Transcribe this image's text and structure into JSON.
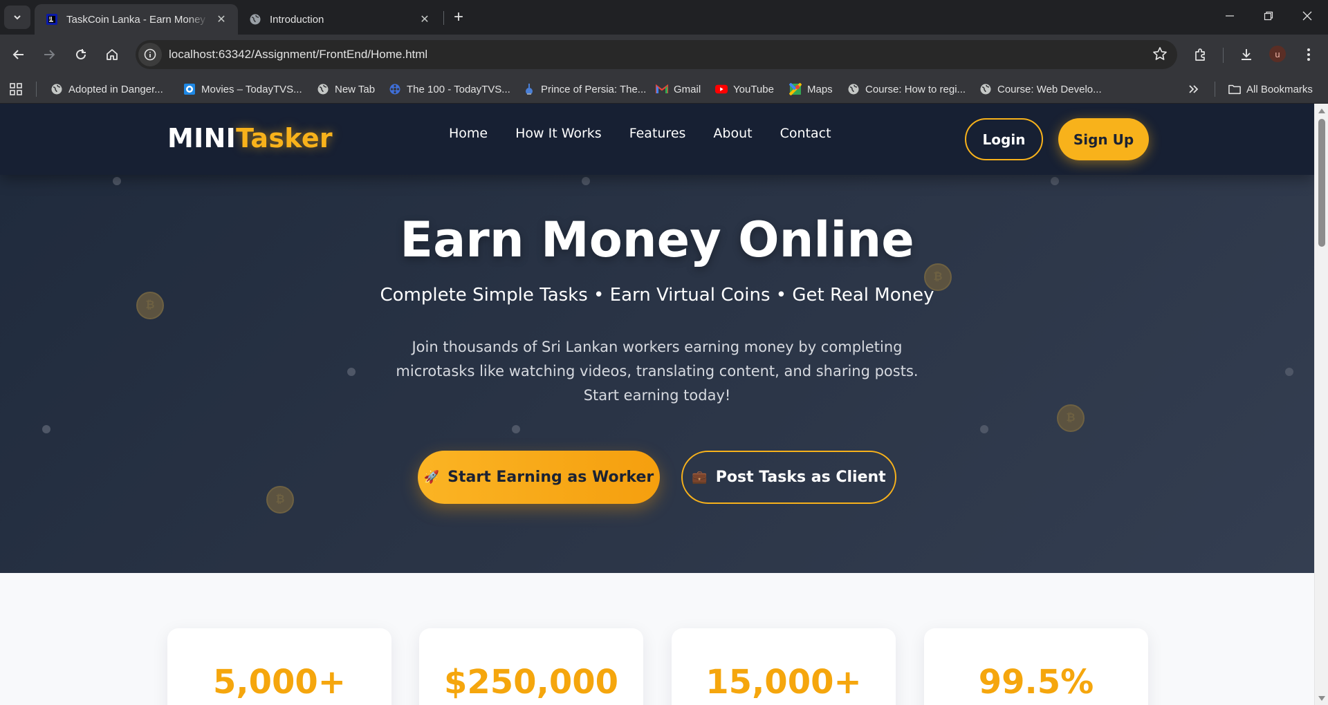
{
  "browser": {
    "tabs": [
      {
        "title": "TaskCoin Lanka - Earn Money O",
        "active": true
      },
      {
        "title": "Introduction",
        "active": false
      }
    ],
    "url": "localhost:63342/Assignment/FrontEnd/Home.html",
    "profile_initial": "u",
    "bookmarks": [
      {
        "label": "Adopted in Danger...",
        "icon": "globe-icon"
      },
      {
        "label": "Movies – TodayTVS...",
        "icon": "site-icon"
      },
      {
        "label": "New Tab",
        "icon": "globe-icon"
      },
      {
        "label": "The 100 - TodayTVS...",
        "icon": "reel-icon"
      },
      {
        "label": "Prince of Persia: The...",
        "icon": "game-icon"
      },
      {
        "label": "Gmail",
        "icon": "gmail-icon"
      },
      {
        "label": "YouTube",
        "icon": "youtube-icon"
      },
      {
        "label": "Maps",
        "icon": "maps-icon"
      },
      {
        "label": "Course: How to regi...",
        "icon": "globe-icon"
      },
      {
        "label": "Course: Web Develo...",
        "icon": "globe-icon"
      }
    ],
    "all_bookmarks_label": "All Bookmarks"
  },
  "site": {
    "logo": {
      "part1": "MINI",
      "part2": "Tasker"
    },
    "nav": [
      "Home",
      "How It Works",
      "Features",
      "About",
      "Contact"
    ],
    "login_label": "Login",
    "signup_label": "Sign Up",
    "hero": {
      "title": "Earn Money Online",
      "subtitle": "Complete Simple Tasks • Earn Virtual Coins • Get Real Money",
      "description": "Join thousands of Sri Lankan workers earning money by completing microtasks like watching videos, translating content, and sharing posts. Start earning today!",
      "worker_button": "Start Earning as Worker",
      "worker_icon": "🚀",
      "client_button": "Post Tasks as Client",
      "client_icon": "💼"
    },
    "stats": [
      "5,000+",
      "$250,000",
      "15,000+",
      "99.5%"
    ]
  },
  "colors": {
    "accent": "#f8b21b",
    "hero_bg": "#2a3446",
    "navbar_bg": "#172033"
  }
}
